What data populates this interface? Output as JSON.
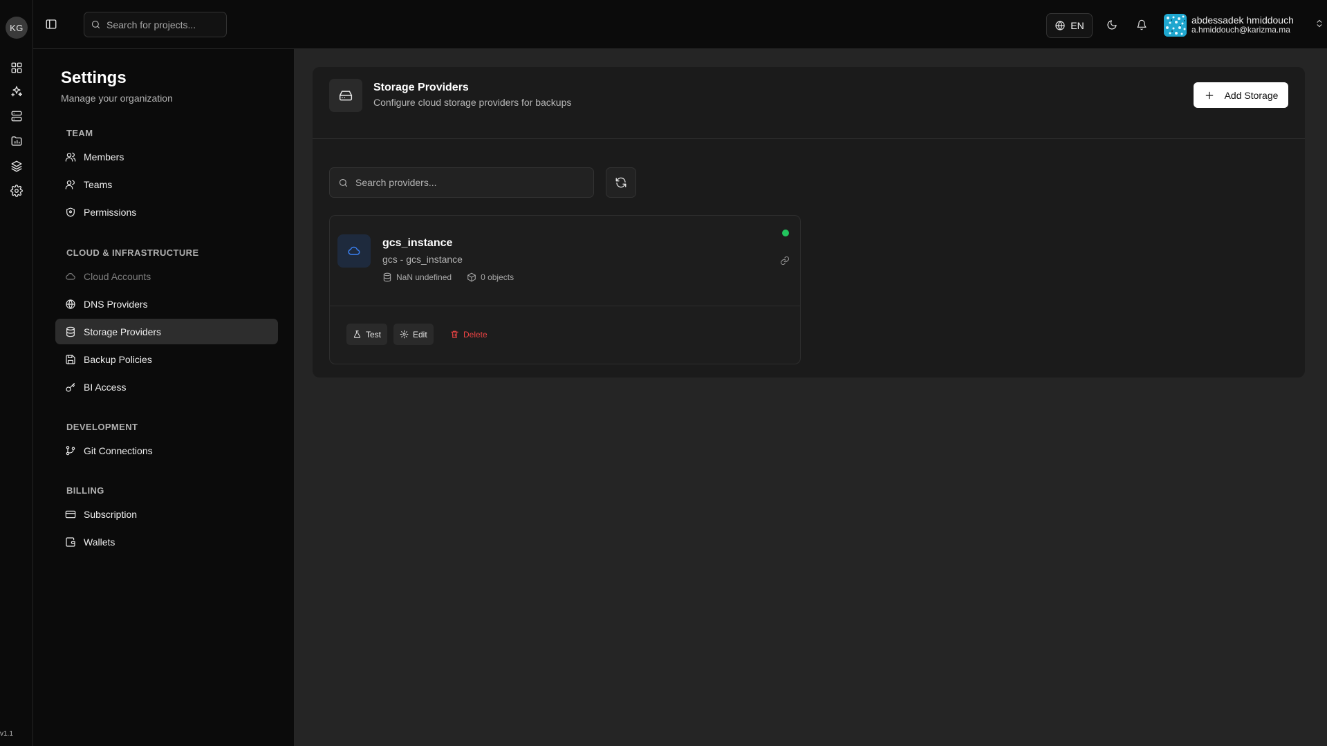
{
  "rail": {
    "org_initials": "KG",
    "version": "v1.1",
    "icons": [
      "dashboard-icon",
      "sparkles-icon",
      "server-icon",
      "folder-chart-icon",
      "layers-icon",
      "settings-icon"
    ]
  },
  "topbar": {
    "search_placeholder": "Search for projects...",
    "language": "EN",
    "user": {
      "name": "abdessadek hmiddouch",
      "email": "a.hmiddouch@karizma.ma"
    }
  },
  "settings": {
    "title": "Settings",
    "subtitle": "Manage your organization",
    "sections": [
      {
        "label": "TEAM",
        "items": [
          {
            "label": "Members",
            "icon": "users-icon"
          },
          {
            "label": "Teams",
            "icon": "users-icon"
          },
          {
            "label": "Permissions",
            "icon": "shield-icon"
          }
        ]
      },
      {
        "label": "CLOUD & INFRASTRUCTURE",
        "items": [
          {
            "label": "Cloud Accounts",
            "icon": "cloud-icon",
            "disabled": true
          },
          {
            "label": "DNS Providers",
            "icon": "globe-icon"
          },
          {
            "label": "Storage Providers",
            "icon": "database-icon",
            "active": true
          },
          {
            "label": "Backup Policies",
            "icon": "save-icon"
          },
          {
            "label": "BI Access",
            "icon": "key-icon"
          }
        ]
      },
      {
        "label": "DEVELOPMENT",
        "items": [
          {
            "label": "Git Connections",
            "icon": "git-branch-icon"
          }
        ]
      },
      {
        "label": "BILLING",
        "items": [
          {
            "label": "Subscription",
            "icon": "credit-card-icon"
          },
          {
            "label": "Wallets",
            "icon": "wallet-icon"
          }
        ]
      }
    ]
  },
  "main": {
    "header": {
      "title": "Storage Providers",
      "subtitle": "Configure cloud storage providers for backups",
      "add_label": "Add Storage"
    },
    "search_placeholder": "Search providers...",
    "providers": [
      {
        "name": "gcs_instance",
        "type_line": "gcs - gcs_instance",
        "size": "NaN undefined",
        "objects": "0 objects",
        "status_color": "#22c55e",
        "actions": {
          "test": "Test",
          "edit": "Edit",
          "delete": "Delete"
        }
      }
    ]
  },
  "colors": {
    "accent_blue": "#3b82f6",
    "danger": "#ef4444",
    "success": "#22c55e"
  }
}
